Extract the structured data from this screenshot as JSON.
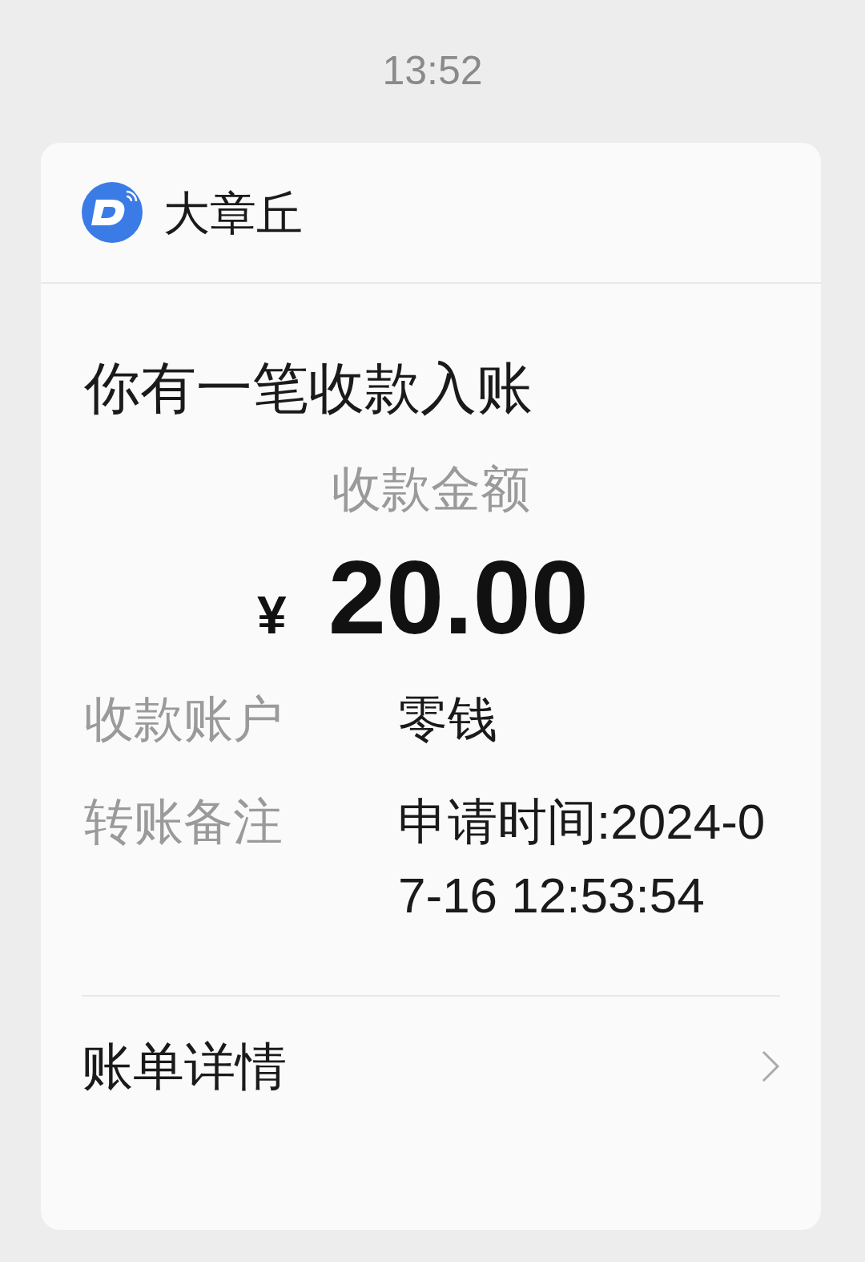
{
  "status_time": "13:52",
  "card": {
    "app_name": "大章丘",
    "title": "你有一笔收款入账",
    "amount_label": "收款金额",
    "currency": "¥",
    "amount": "20.00",
    "rows": [
      {
        "label": "收款账户",
        "value": "零钱"
      },
      {
        "label": "转账备注",
        "value": "申请时间:2024-07-16 12:53:54"
      }
    ],
    "footer_link": "账单详情"
  }
}
